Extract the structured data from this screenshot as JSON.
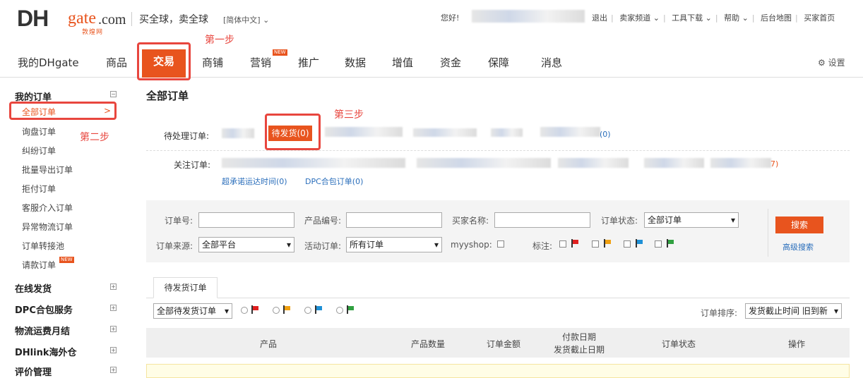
{
  "header": {
    "logo_text": "DHgate.com",
    "logo_sub": "敦煌网",
    "slogan": "买全球，卖全球",
    "language": "[简体中文]",
    "greeting": "您好!",
    "links": [
      "退出",
      "卖家频道",
      "工具下载",
      "帮助",
      "后台地图",
      "买家首页"
    ]
  },
  "nav": {
    "items": [
      "我的DHgate",
      "商品",
      "交易",
      "商铺",
      "营销",
      "推广",
      "数据",
      "增值",
      "资金",
      "保障",
      "消息"
    ],
    "active": "交易",
    "new_badge": "NEW",
    "settings": "设置"
  },
  "annotations": {
    "step1": "第一步",
    "step2": "第二步",
    "step3": "第三步"
  },
  "sidebar": {
    "group1": "我的订单",
    "group1_items": [
      "全部订单",
      "询盘订单",
      "纠纷订单",
      "批量导出订单",
      "拒付订单",
      "客服介入订单",
      "异常物流订单",
      "订单转接池",
      "请款订单"
    ],
    "active_item_arrow": ">",
    "new_badge": "NEW",
    "groups": [
      "在线发货",
      "DPC合包服务",
      "物流运费月结",
      "DHlink海外仓",
      "评价管理"
    ]
  },
  "main": {
    "title": "全部订单",
    "pending_label": "待处理订单:",
    "pending_button": "待发货(0)",
    "pending_tail": "(0)",
    "watch_label": "关注订单:",
    "watch_tail": "7)",
    "watch_links": [
      "超承诺运达时间(0)",
      "DPC合包订单(0)"
    ]
  },
  "search": {
    "order_no": "订单号:",
    "product_no": "产品编号:",
    "buyer_name": "买家名称:",
    "order_status": "订单状态:",
    "order_status_value": "全部订单",
    "order_source": "订单来源:",
    "order_source_value": "全部平台",
    "activity": "活动订单:",
    "activity_value": "所有订单",
    "myyshop": "myyshop:",
    "mark": "标注:",
    "search_button": "搜索",
    "advanced": "高级搜索"
  },
  "tab": {
    "label": "待发货订单",
    "filter_value": "全部待发货订单",
    "sort_label": "订单排序:",
    "sort_value": "发货截止时间 旧到新"
  },
  "table": {
    "headers": [
      "产品",
      "产品数量",
      "订单金额",
      "付款日期",
      "发货截止日期",
      "订单状态",
      "操作"
    ]
  },
  "colors": {
    "accent": "#e8541e",
    "annotation": "#e8463e",
    "link": "#2a6ebb",
    "flag_red": "#e02020",
    "flag_orange": "#f0a010",
    "flag_blue": "#1e90d6",
    "flag_green": "#30a040"
  }
}
